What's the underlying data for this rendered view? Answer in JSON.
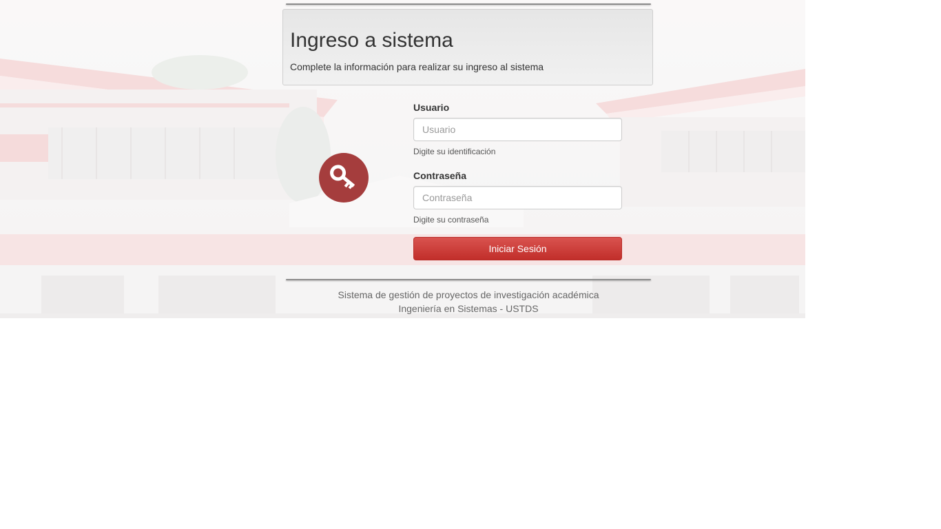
{
  "header": {
    "title": "Ingreso a sistema",
    "subtitle": "Complete la información para realizar su ingreso al sistema"
  },
  "form": {
    "user_label": "Usuario",
    "user_placeholder": "Usuario",
    "user_value": "",
    "user_help": "Digite su identificación",
    "password_label": "Contraseña",
    "password_placeholder": "Contraseña",
    "password_value": "",
    "password_help": "Digite su contraseña",
    "submit_label": "Iniciar Sesión"
  },
  "footer": {
    "line1": "Sistema de gestión de proyectos de investigación académica",
    "line2": "Ingeniería en Sistemas - USTDS"
  },
  "icons": {
    "login": "key-icon"
  },
  "colors": {
    "brand_red": "#d9534f",
    "key_circle": "#a53d3d"
  }
}
